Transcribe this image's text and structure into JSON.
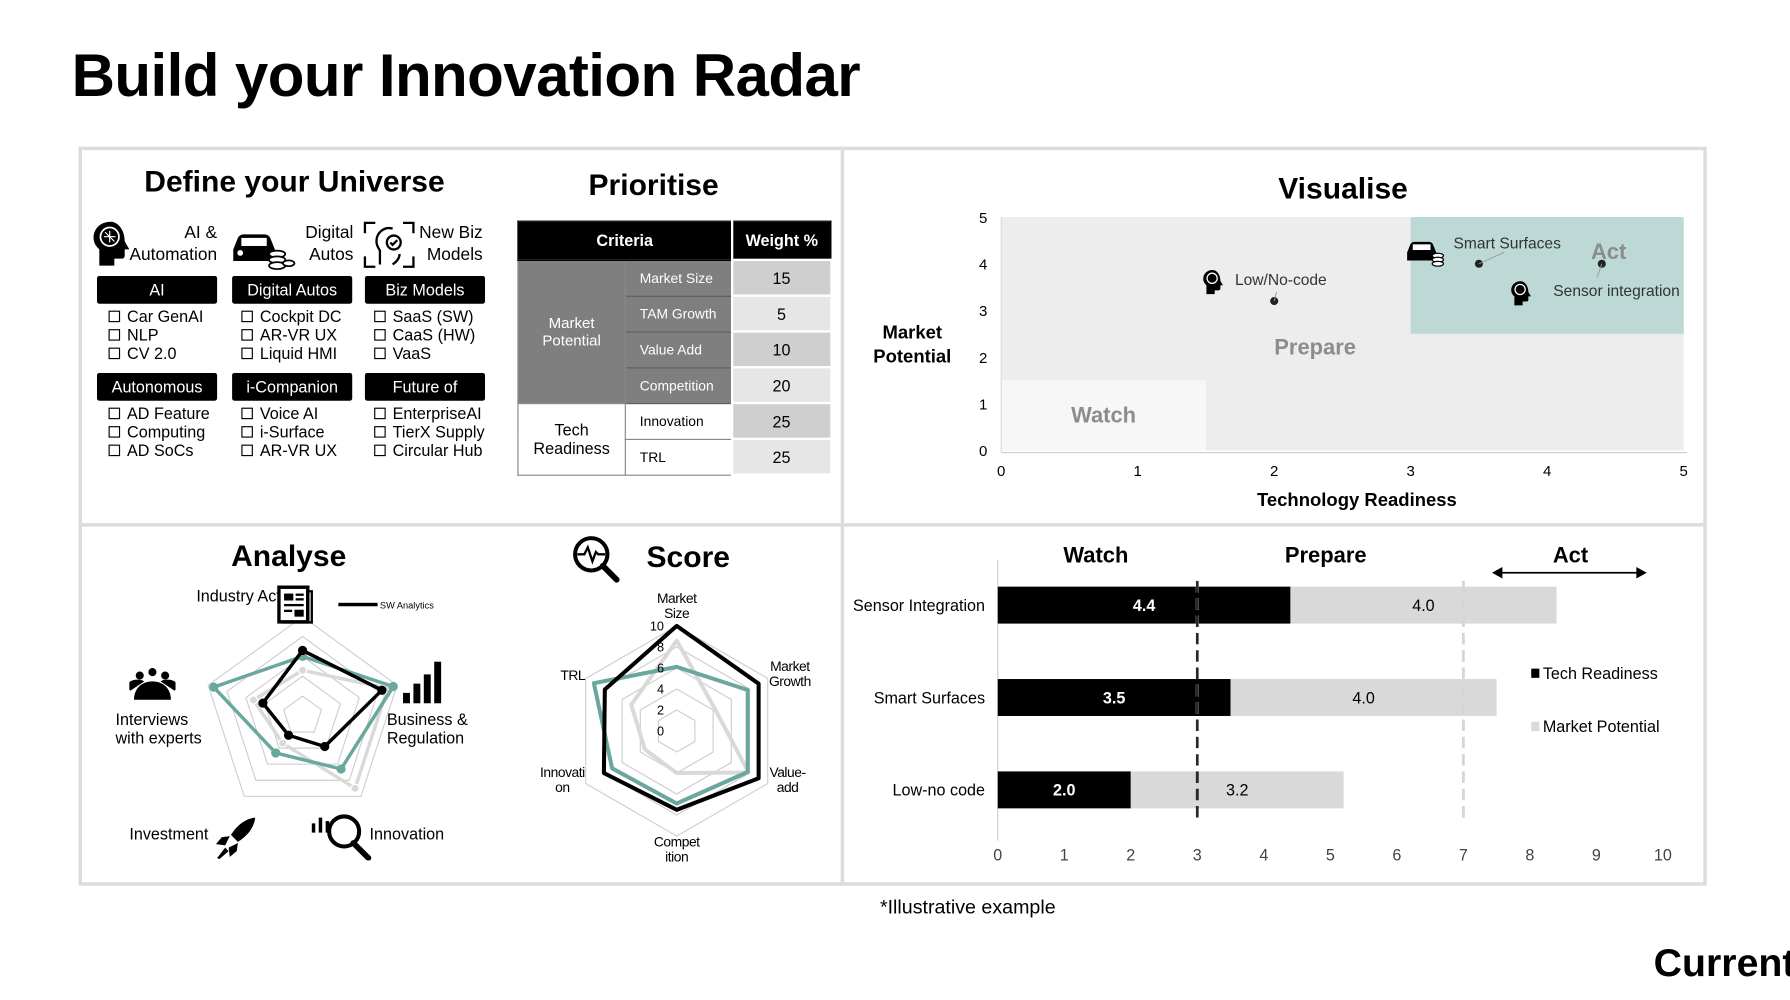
{
  "title": "Build your Innovation Radar",
  "define": {
    "title": "Define your Universe",
    "categories": [
      {
        "icon": "brain-head-icon",
        "line1": "AI &",
        "line2": "Automation"
      },
      {
        "icon": "car-coins-icon",
        "line1": "Digital",
        "line2": "Autos"
      },
      {
        "icon": "face-scan-icon",
        "line1": "New Biz",
        "line2": "Models"
      }
    ],
    "groups": [
      {
        "header": "AI",
        "items": [
          "Car GenAI",
          "NLP",
          "CV 2.0"
        ]
      },
      {
        "header": "Digital Autos",
        "items": [
          "Cockpit DC",
          "AR-VR UX",
          "Liquid HMI"
        ]
      },
      {
        "header": "Biz Models",
        "items": [
          "SaaS (SW)",
          "CaaS (HW)",
          "VaaS"
        ]
      },
      {
        "header": "Autonomous",
        "items": [
          "AD Feature",
          "Computing",
          "AD SoCs"
        ]
      },
      {
        "header": "i-Companion",
        "items": [
          "Voice AI",
          "i-Surface",
          "AR-VR UX"
        ]
      },
      {
        "header": "Future of",
        "items": [
          "EnterpriseAI",
          "TierX Supply",
          "Circular Hub"
        ]
      }
    ]
  },
  "prioritise": {
    "title": "Prioritise",
    "headers": [
      "Criteria",
      "Weight %"
    ],
    "groups": [
      {
        "name_line1": "Market",
        "name_line2": "Potential",
        "rows": [
          {
            "criterion": "Market Size",
            "weight": "15"
          },
          {
            "criterion": "TAM Growth",
            "weight": "5"
          },
          {
            "criterion": "Value Add",
            "weight": "10"
          },
          {
            "criterion": "Competition",
            "weight": "20"
          }
        ]
      },
      {
        "name_line1": "Tech",
        "name_line2": "Readiness",
        "rows": [
          {
            "criterion": "Innovation",
            "weight": "25"
          },
          {
            "criterion": "TRL",
            "weight": "25"
          }
        ]
      }
    ]
  },
  "visualise": {
    "title": "Visualise"
  },
  "analyse": {
    "title": "Analyse",
    "axis_icons": [
      "newspaper-icon",
      "bar-chart-icon",
      "magnifier-chart-icon",
      "rocket-icon",
      "people-icon"
    ]
  },
  "score": {
    "title": "Score",
    "icon": "magnifier-pulse-icon"
  },
  "colors": {
    "teal": "#6aa79d",
    "act_zone": "#bcd9d5",
    "prepare_zone": "#ededed",
    "watch_zone": "#f7f7f7",
    "tech": "#000000",
    "market": "#d9d9d9",
    "gray_series": "#d9d9d9"
  },
  "footnote": "*Illustrative example",
  "brand": "Current",
  "chart_data": [
    {
      "type": "scatter",
      "id": "visualise",
      "xlabel": "Technology Readiness",
      "ylabel_line1": "Market",
      "ylabel_line2": "Potential",
      "xlim": [
        0,
        5
      ],
      "ylim": [
        0,
        5
      ],
      "xticks": [
        "0",
        "1",
        "2",
        "3",
        "4",
        "5"
      ],
      "yticks": [
        "0",
        "1",
        "2",
        "3",
        "4",
        "5"
      ],
      "zones": [
        {
          "label": "Watch",
          "x": [
            0,
            1.5
          ],
          "y": [
            0,
            1.5
          ]
        },
        {
          "label": "Prepare",
          "x": [
            0,
            5
          ],
          "y": [
            0,
            5
          ]
        },
        {
          "label": "Act",
          "x": [
            3,
            5
          ],
          "y": [
            2.5,
            5
          ]
        }
      ],
      "points": [
        {
          "label": "Low/No-code",
          "x": 2.0,
          "y": 3.2,
          "icon": "brain-head-icon"
        },
        {
          "label": "Smart Surfaces",
          "x": 3.5,
          "y": 4.0,
          "icon": "car-coins-icon"
        },
        {
          "label": "Sensor integration",
          "x": 4.4,
          "y": 4.0,
          "icon": "brain-head-icon"
        }
      ]
    },
    {
      "type": "bar",
      "id": "stacked",
      "orientation": "horizontal",
      "stacked": true,
      "categories": [
        "Sensor Integration",
        "Smart Surfaces",
        "Low-no code"
      ],
      "series": [
        {
          "name": "Tech Readiness",
          "values": [
            4.4,
            3.5,
            2.0
          ],
          "labels": [
            "4.4",
            "3.5",
            "2.0"
          ]
        },
        {
          "name": "Market Potential",
          "values": [
            4.0,
            4.0,
            3.2
          ],
          "labels": [
            "4.0",
            "4.0",
            "3.2"
          ]
        }
      ],
      "xlim": [
        0,
        10
      ],
      "xticks": [
        "0",
        "1",
        "2",
        "3",
        "4",
        "5",
        "6",
        "7",
        "8",
        "9",
        "10"
      ],
      "thresholds": [
        3,
        7
      ],
      "zones": [
        "Watch",
        "Prepare",
        "Act"
      ],
      "legend": "right"
    },
    {
      "type": "radar",
      "id": "analyse",
      "axes": [
        "Industry Activity",
        "Business & Regulation",
        "Innovation",
        "Investment",
        "Interviews with experts"
      ],
      "rmax": 5,
      "rings": 5,
      "series": [
        {
          "name": "SW Analytics",
          "color": "#000000",
          "values": [
            3.3,
            4.2,
            1.9,
            1.2,
            2.1
          ]
        },
        {
          "color": "#6aa79d",
          "values": [
            3.0,
            4.8,
            3.3,
            2.3,
            4.7
          ]
        },
        {
          "color": "#d9d9d9",
          "values": [
            2.3,
            4.5,
            4.5,
            1.7,
            2.6
          ]
        }
      ],
      "legend": "top-right"
    },
    {
      "type": "radar",
      "id": "score",
      "axes": [
        "Market Size",
        "Market Growth",
        "Value-add",
        "Competition",
        "Innovation",
        "TRL"
      ],
      "axis_labels": [
        [
          "Market",
          "Size"
        ],
        [
          "Market",
          "Growth"
        ],
        [
          "Value-",
          "add"
        ],
        [
          "Compet",
          "ition"
        ],
        [
          "Innovati",
          "on"
        ],
        [
          "TRL"
        ]
      ],
      "rmax": 10,
      "rings": 5,
      "rticks": [
        "0",
        "2",
        "4",
        "6",
        "8",
        "10"
      ],
      "series": [
        {
          "color": "#000000",
          "values": [
            10,
            9.0,
            9.0,
            7.5,
            8.0,
            7.9
          ]
        },
        {
          "color": "#6aa79d",
          "values": [
            6.1,
            7.8,
            7.8,
            6.9,
            7.1,
            9.1
          ]
        },
        {
          "color": "#d9d9d9",
          "values": [
            8.6,
            4.2,
            7.9,
            4.0,
            3.5,
            5.0
          ]
        }
      ]
    }
  ]
}
